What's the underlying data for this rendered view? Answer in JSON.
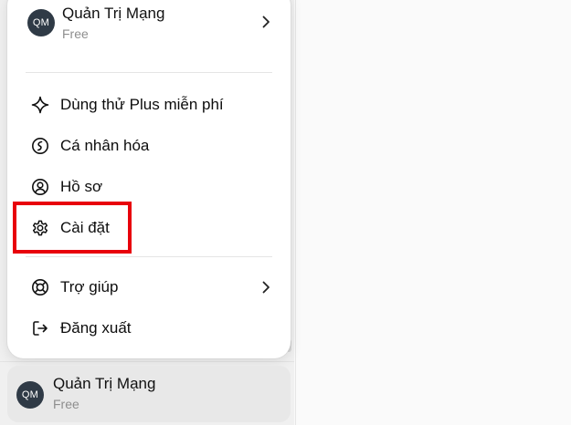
{
  "menu": {
    "account": {
      "avatar_initials": "QM",
      "name": "Quản Trị Mạng",
      "plan": "Free"
    },
    "items": [
      {
        "label": "Dùng thử Plus miễn phí",
        "icon": "sparkle-icon"
      },
      {
        "label": "Cá nhân hóa",
        "icon": "personalize-icon"
      },
      {
        "label": "Hồ sơ",
        "icon": "profile-icon"
      },
      {
        "label": "Cài đặt",
        "icon": "gear-icon",
        "highlighted": true
      },
      {
        "label": "Trợ giúp",
        "icon": "lifebuoy-icon",
        "has_submenu": true
      },
      {
        "label": "Đăng xuất",
        "icon": "logout-icon"
      }
    ]
  },
  "sidebar": {
    "account": {
      "avatar_initials": "QM",
      "name": "Quản Trị Mạng",
      "plan": "Free"
    }
  },
  "colors": {
    "highlight_border": "#e8000b",
    "avatar_bg": "#2f3a46",
    "menu_bg": "#ffffff"
  }
}
